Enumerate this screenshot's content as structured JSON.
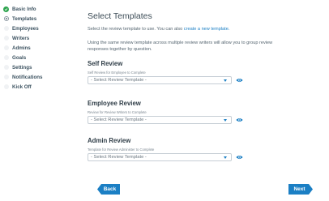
{
  "sidebar": {
    "items": [
      {
        "label": "Basic Info",
        "state": "done"
      },
      {
        "label": "Templates",
        "state": "current"
      },
      {
        "label": "Employees",
        "state": "todo"
      },
      {
        "label": "Writers",
        "state": "todo"
      },
      {
        "label": "Admins",
        "state": "todo"
      },
      {
        "label": "Goals",
        "state": "todo"
      },
      {
        "label": "Settings",
        "state": "todo"
      },
      {
        "label": "Notifications",
        "state": "todo"
      },
      {
        "label": "Kick Off",
        "state": "todo"
      }
    ]
  },
  "main": {
    "title": "Select Templates",
    "intro_text": "Select the review template to use. You can also",
    "intro_link": "create a new template.",
    "info_line1": "Using the same review template across multiple review writers will allow you to group review",
    "info_line2": "responses together by question.",
    "sections": [
      {
        "title": "Self Review",
        "subtitle": "Self Review for Employee to Complete",
        "select_value": "- Select Review Template -"
      },
      {
        "title": "Employee Review",
        "subtitle": "Review for Review Writers to Complete",
        "select_value": "- Select Review Template -"
      },
      {
        "title": "Admin Review",
        "subtitle": "Template for Review Administer to Complete",
        "select_value": "- Select Review Template -"
      }
    ]
  },
  "footer": {
    "back_label": "Back",
    "next_label": "Next"
  },
  "colors": {
    "accent": "#1b7fc4",
    "done": "#2ea44f"
  }
}
